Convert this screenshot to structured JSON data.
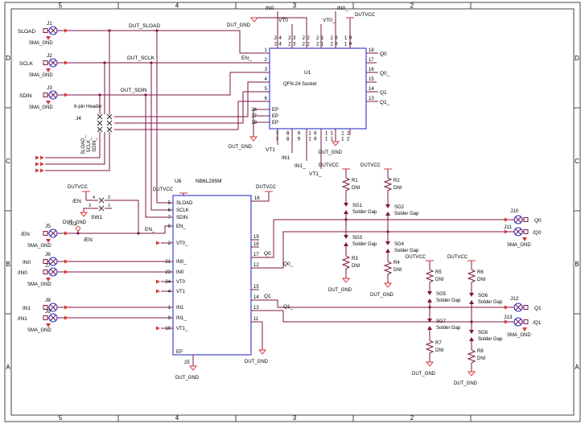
{
  "frame": {
    "cols": [
      "5",
      "4",
      "3",
      "2"
    ],
    "rows": [
      "D",
      "C",
      "B",
      "A"
    ]
  },
  "power": {
    "vcc": "DUTVCC",
    "gnd": "DUT_GND",
    "sma_gnd": "SMA_GND"
  },
  "inputs": {
    "j1": {
      "ref": "J1",
      "net": "SLOAD",
      "out": "DUT_SLOAD"
    },
    "j2": {
      "ref": "J2",
      "net": "SCLK",
      "out": "DUT_SCLK"
    },
    "j3": {
      "ref": "J3",
      "net": "SDIN",
      "out": "DUT_SDIN"
    }
  },
  "header": {
    "ref": "J4",
    "label": "6-pin Header",
    "nets": [
      "SLOAD_",
      "SCLK_",
      "SDIN_"
    ]
  },
  "sw": {
    "ref": "SW1",
    "net": "/EN",
    "pins": [
      "4",
      "2",
      "3",
      "1"
    ]
  },
  "tp": {
    "ref": "TP1",
    "net": "/EN"
  },
  "mid": {
    "j5": {
      "ref": "J5",
      "net": "/EN"
    },
    "j6": {
      "ref": "J6",
      "net": "IN0"
    },
    "j7": {
      "ref": "J7",
      "net": "/IN0"
    },
    "j8": {
      "ref": "J8",
      "net": "IN1"
    },
    "j9": {
      "ref": "J9",
      "net": "/IN1"
    }
  },
  "outputs": {
    "j10": {
      "ref": "J10",
      "net": "Q0"
    },
    "j11": {
      "ref": "J11",
      "net": "/Q0"
    },
    "j12": {
      "ref": "J12",
      "net": "Q1"
    },
    "j13": {
      "ref": "J13",
      "net": "/Q1"
    }
  },
  "u1": {
    "ref": "U1",
    "name": "QFN-24 Socket",
    "top_nums": "24 23 22 21 20 19",
    "bot_nums": "7 8 9 10 11 12",
    "left": [
      "1",
      "2",
      "3",
      "4",
      "5",
      "6"
    ],
    "right": [
      "18",
      "17",
      "16",
      "15",
      "14",
      "13"
    ],
    "ep_nums": [
      "26",
      "27",
      "28"
    ],
    "ep_name": "EP",
    "en": "EN_",
    "nets": {
      "in0": "IN0",
      "vt0": "VT0",
      "vt0b": "VT0_",
      "in0b": "IN0_",
      "vt1": "VT1",
      "in1": "IN1",
      "in1b": "IN1_",
      "vt1b": "VT1_",
      "q0": "Q0",
      "q0b": "Q0_",
      "q1": "Q1",
      "q1b": "Q1_"
    }
  },
  "u6": {
    "ref": "U6",
    "name": "NB6L295M",
    "en": "EN_",
    "left": [
      {
        "n": "5",
        "l": "SLOAD"
      },
      {
        "n": "6",
        "l": "SCLK"
      },
      {
        "n": "7",
        "l": "SDIN"
      },
      {
        "n": "8",
        "l": "EN_"
      },
      {
        "n": "2",
        "l": "VT0_"
      },
      {
        "n": "21",
        "l": "IN0_"
      },
      {
        "n": "23",
        "l": "IN0"
      },
      {
        "n": "24",
        "l": "VT0"
      },
      {
        "n": "4",
        "l": "VT1"
      },
      {
        "n": "1",
        "l": "IN1"
      },
      {
        "n": "9",
        "l": "IN1_"
      },
      {
        "n": "10",
        "l": "VT1_"
      }
    ],
    "right": [
      "19",
      "18",
      "17",
      "12",
      "15",
      "14",
      "13",
      "11"
    ],
    "vcc_pin": "16",
    "ep_n": "25",
    "ep_l": "EP",
    "out": {
      "q0": "Q0",
      "q0b": "Q0_",
      "q1": "Q1",
      "q1b": "Q1_"
    }
  },
  "resistors": [
    {
      "ref": "R1",
      "val": "DNI"
    },
    {
      "ref": "R2",
      "val": "DNI"
    },
    {
      "ref": "R3",
      "val": "DNI"
    },
    {
      "ref": "R4",
      "val": "DNI"
    },
    {
      "ref": "R5",
      "val": "DNI"
    },
    {
      "ref": "R6",
      "val": "DNI"
    },
    {
      "ref": "R7",
      "val": "DNI"
    },
    {
      "ref": "R8",
      "val": "DNI"
    }
  ],
  "gaps": [
    {
      "ref": "SG1",
      "label": "Solder Gap"
    },
    {
      "ref": "SG2",
      "label": "Solder Gap"
    },
    {
      "ref": "SG3",
      "label": "Solder Gap"
    },
    {
      "ref": "SG4",
      "label": "Solder Gap"
    },
    {
      "ref": "SG5",
      "label": "Solder Gap"
    },
    {
      "ref": "SG6",
      "label": "Solder Gap"
    },
    {
      "ref": "SG7",
      "label": "Solder Gap"
    },
    {
      "ref": "SG8",
      "label": "Solder Gap"
    }
  ]
}
